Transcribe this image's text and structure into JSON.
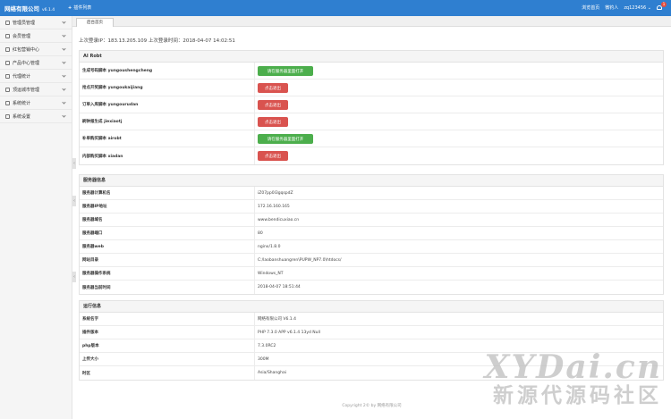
{
  "header": {
    "brand": "网络有限公司",
    "version": "v6.1.4",
    "plugin_menu": "插件列表",
    "links": [
      "浏览首页",
      "微钓人"
    ],
    "user": "zq123456",
    "user_caret": "⌄",
    "badge": "1"
  },
  "sidebar": {
    "items": [
      {
        "label": "管理员管理"
      },
      {
        "label": "会员管理"
      },
      {
        "label": "红包营销中心"
      },
      {
        "label": "产品中心管理"
      },
      {
        "label": "代理统计"
      },
      {
        "label": "顶运城市管理"
      },
      {
        "label": "系统统计"
      },
      {
        "label": "系统设置"
      }
    ]
  },
  "tabs": [
    "后台首页"
  ],
  "login_info": "上次登录IP：183.13.205.109 上次登录时间：2018-04-07 14:02:51",
  "scripts_panel": {
    "title": "AI Robt",
    "rows": [
      {
        "label": "生成号码脚本 yungoushengcheng",
        "button": "请在服务器里面打开",
        "style": "green"
      },
      {
        "label": "抢点开奖脚本 yungoukaijiang",
        "button": "点击退出",
        "style": "red"
      },
      {
        "label": "订单入库脚本 yungourudan",
        "button": "点击退出",
        "style": "red"
      },
      {
        "label": "刷钟报生成 jiexiaotj",
        "button": "点击退出",
        "style": "red"
      },
      {
        "label": "补单购买脚本 airobt",
        "button": "请在服务器里面打开",
        "style": "green"
      },
      {
        "label": "内部购买脚本 xiadan",
        "button": "点击退出",
        "style": "red"
      }
    ]
  },
  "server_panel": {
    "title": "服务器信息",
    "rows": [
      {
        "label": "服务器计算机名",
        "value": "iZ07pp0l3gqspdZ"
      },
      {
        "label": "服务器IP地址",
        "value": "172.16.160.165"
      },
      {
        "label": "服务器域名",
        "value": "www.bendicuxiao.cn"
      },
      {
        "label": "服务器端口",
        "value": "80"
      },
      {
        "label": "服务器web",
        "value": "nginx/1.8.0"
      },
      {
        "label": "网站目录",
        "value": "C:/laobanshuangren\\PUPW_NP7.0\\htdocs/"
      },
      {
        "label": "服务器操作系统",
        "value": "Windows_NT"
      },
      {
        "label": "服务器当前时间",
        "value": "2018-04-07 18:51:44"
      }
    ]
  },
  "run_panel": {
    "title": "运行信息",
    "rows": [
      {
        "label": "系统名字",
        "value": "网络有限公司 V6.1.4"
      },
      {
        "label": "插件版本",
        "value": "PHP 7.3.0 APP v6.1.4 13yd Null"
      },
      {
        "label": "php版本",
        "value": "7.3.0RC2"
      },
      {
        "label": "上传大小",
        "value": "300M"
      },
      {
        "label": "时区",
        "value": "Asia/Shanghai"
      }
    ]
  },
  "footer": "Copyright 2© by 网络有限公司",
  "watermark": {
    "top": "XYDai.cn",
    "bottom": "新源代源码社区"
  },
  "colors": {
    "primary": "#2f7fd0",
    "green": "#4cae4c",
    "red": "#d9534f"
  }
}
